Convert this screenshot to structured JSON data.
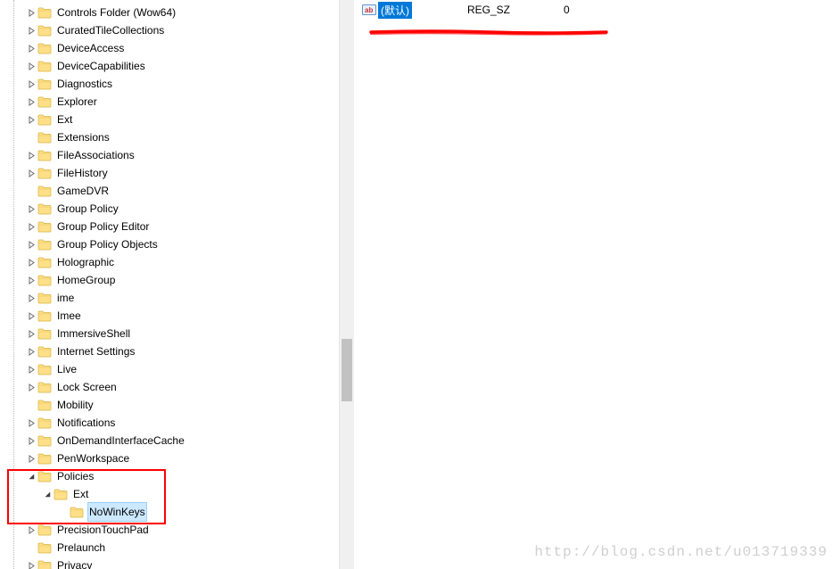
{
  "tree": {
    "items": [
      {
        "label": "Controls Folder (Wow64)",
        "depth": 1,
        "expander": "closed"
      },
      {
        "label": "CuratedTileCollections",
        "depth": 1,
        "expander": "closed"
      },
      {
        "label": "DeviceAccess",
        "depth": 1,
        "expander": "closed"
      },
      {
        "label": "DeviceCapabilities",
        "depth": 1,
        "expander": "closed"
      },
      {
        "label": "Diagnostics",
        "depth": 1,
        "expander": "closed"
      },
      {
        "label": "Explorer",
        "depth": 1,
        "expander": "closed"
      },
      {
        "label": "Ext",
        "depth": 1,
        "expander": "closed"
      },
      {
        "label": "Extensions",
        "depth": 1,
        "expander": "none"
      },
      {
        "label": "FileAssociations",
        "depth": 1,
        "expander": "closed"
      },
      {
        "label": "FileHistory",
        "depth": 1,
        "expander": "closed"
      },
      {
        "label": "GameDVR",
        "depth": 1,
        "expander": "none"
      },
      {
        "label": "Group Policy",
        "depth": 1,
        "expander": "closed"
      },
      {
        "label": "Group Policy Editor",
        "depth": 1,
        "expander": "closed"
      },
      {
        "label": "Group Policy Objects",
        "depth": 1,
        "expander": "closed"
      },
      {
        "label": "Holographic",
        "depth": 1,
        "expander": "closed"
      },
      {
        "label": "HomeGroup",
        "depth": 1,
        "expander": "closed"
      },
      {
        "label": "ime",
        "depth": 1,
        "expander": "closed"
      },
      {
        "label": "Imee",
        "depth": 1,
        "expander": "closed"
      },
      {
        "label": "ImmersiveShell",
        "depth": 1,
        "expander": "closed"
      },
      {
        "label": "Internet Settings",
        "depth": 1,
        "expander": "closed"
      },
      {
        "label": "Live",
        "depth": 1,
        "expander": "closed"
      },
      {
        "label": "Lock Screen",
        "depth": 1,
        "expander": "closed"
      },
      {
        "label": "Mobility",
        "depth": 1,
        "expander": "none"
      },
      {
        "label": "Notifications",
        "depth": 1,
        "expander": "closed"
      },
      {
        "label": "OnDemandInterfaceCache",
        "depth": 1,
        "expander": "closed"
      },
      {
        "label": "PenWorkspace",
        "depth": 1,
        "expander": "closed"
      },
      {
        "label": "Policies",
        "depth": 1,
        "expander": "open"
      },
      {
        "label": "Ext",
        "depth": 2,
        "expander": "open"
      },
      {
        "label": "NoWinKeys",
        "depth": 3,
        "expander": "none",
        "selected": true
      },
      {
        "label": "PrecisionTouchPad",
        "depth": 1,
        "expander": "closed"
      },
      {
        "label": "Prelaunch",
        "depth": 1,
        "expander": "none"
      },
      {
        "label": "Privacy",
        "depth": 1,
        "expander": "closed"
      }
    ]
  },
  "list": {
    "row": {
      "name": "(默认)",
      "type": "REG_SZ",
      "data": "0"
    }
  },
  "watermark": "http://blog.csdn.net/u013719339"
}
